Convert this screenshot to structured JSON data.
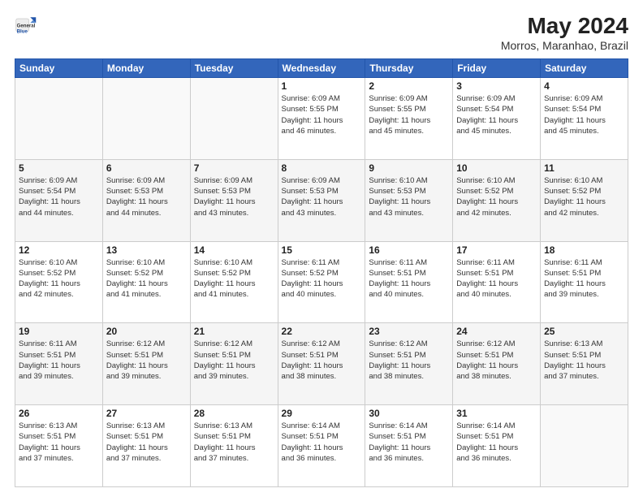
{
  "header": {
    "logo_general": "General",
    "logo_blue": "Blue",
    "title": "May 2024",
    "location": "Morros, Maranhao, Brazil"
  },
  "days_of_week": [
    "Sunday",
    "Monday",
    "Tuesday",
    "Wednesday",
    "Thursday",
    "Friday",
    "Saturday"
  ],
  "weeks": [
    [
      {
        "num": "",
        "info": ""
      },
      {
        "num": "",
        "info": ""
      },
      {
        "num": "",
        "info": ""
      },
      {
        "num": "1",
        "info": "Sunrise: 6:09 AM\nSunset: 5:55 PM\nDaylight: 11 hours\nand 46 minutes."
      },
      {
        "num": "2",
        "info": "Sunrise: 6:09 AM\nSunset: 5:55 PM\nDaylight: 11 hours\nand 45 minutes."
      },
      {
        "num": "3",
        "info": "Sunrise: 6:09 AM\nSunset: 5:54 PM\nDaylight: 11 hours\nand 45 minutes."
      },
      {
        "num": "4",
        "info": "Sunrise: 6:09 AM\nSunset: 5:54 PM\nDaylight: 11 hours\nand 45 minutes."
      }
    ],
    [
      {
        "num": "5",
        "info": "Sunrise: 6:09 AM\nSunset: 5:54 PM\nDaylight: 11 hours\nand 44 minutes."
      },
      {
        "num": "6",
        "info": "Sunrise: 6:09 AM\nSunset: 5:53 PM\nDaylight: 11 hours\nand 44 minutes."
      },
      {
        "num": "7",
        "info": "Sunrise: 6:09 AM\nSunset: 5:53 PM\nDaylight: 11 hours\nand 43 minutes."
      },
      {
        "num": "8",
        "info": "Sunrise: 6:09 AM\nSunset: 5:53 PM\nDaylight: 11 hours\nand 43 minutes."
      },
      {
        "num": "9",
        "info": "Sunrise: 6:10 AM\nSunset: 5:53 PM\nDaylight: 11 hours\nand 43 minutes."
      },
      {
        "num": "10",
        "info": "Sunrise: 6:10 AM\nSunset: 5:52 PM\nDaylight: 11 hours\nand 42 minutes."
      },
      {
        "num": "11",
        "info": "Sunrise: 6:10 AM\nSunset: 5:52 PM\nDaylight: 11 hours\nand 42 minutes."
      }
    ],
    [
      {
        "num": "12",
        "info": "Sunrise: 6:10 AM\nSunset: 5:52 PM\nDaylight: 11 hours\nand 42 minutes."
      },
      {
        "num": "13",
        "info": "Sunrise: 6:10 AM\nSunset: 5:52 PM\nDaylight: 11 hours\nand 41 minutes."
      },
      {
        "num": "14",
        "info": "Sunrise: 6:10 AM\nSunset: 5:52 PM\nDaylight: 11 hours\nand 41 minutes."
      },
      {
        "num": "15",
        "info": "Sunrise: 6:11 AM\nSunset: 5:52 PM\nDaylight: 11 hours\nand 40 minutes."
      },
      {
        "num": "16",
        "info": "Sunrise: 6:11 AM\nSunset: 5:51 PM\nDaylight: 11 hours\nand 40 minutes."
      },
      {
        "num": "17",
        "info": "Sunrise: 6:11 AM\nSunset: 5:51 PM\nDaylight: 11 hours\nand 40 minutes."
      },
      {
        "num": "18",
        "info": "Sunrise: 6:11 AM\nSunset: 5:51 PM\nDaylight: 11 hours\nand 39 minutes."
      }
    ],
    [
      {
        "num": "19",
        "info": "Sunrise: 6:11 AM\nSunset: 5:51 PM\nDaylight: 11 hours\nand 39 minutes."
      },
      {
        "num": "20",
        "info": "Sunrise: 6:12 AM\nSunset: 5:51 PM\nDaylight: 11 hours\nand 39 minutes."
      },
      {
        "num": "21",
        "info": "Sunrise: 6:12 AM\nSunset: 5:51 PM\nDaylight: 11 hours\nand 39 minutes."
      },
      {
        "num": "22",
        "info": "Sunrise: 6:12 AM\nSunset: 5:51 PM\nDaylight: 11 hours\nand 38 minutes."
      },
      {
        "num": "23",
        "info": "Sunrise: 6:12 AM\nSunset: 5:51 PM\nDaylight: 11 hours\nand 38 minutes."
      },
      {
        "num": "24",
        "info": "Sunrise: 6:12 AM\nSunset: 5:51 PM\nDaylight: 11 hours\nand 38 minutes."
      },
      {
        "num": "25",
        "info": "Sunrise: 6:13 AM\nSunset: 5:51 PM\nDaylight: 11 hours\nand 37 minutes."
      }
    ],
    [
      {
        "num": "26",
        "info": "Sunrise: 6:13 AM\nSunset: 5:51 PM\nDaylight: 11 hours\nand 37 minutes."
      },
      {
        "num": "27",
        "info": "Sunrise: 6:13 AM\nSunset: 5:51 PM\nDaylight: 11 hours\nand 37 minutes."
      },
      {
        "num": "28",
        "info": "Sunrise: 6:13 AM\nSunset: 5:51 PM\nDaylight: 11 hours\nand 37 minutes."
      },
      {
        "num": "29",
        "info": "Sunrise: 6:14 AM\nSunset: 5:51 PM\nDaylight: 11 hours\nand 36 minutes."
      },
      {
        "num": "30",
        "info": "Sunrise: 6:14 AM\nSunset: 5:51 PM\nDaylight: 11 hours\nand 36 minutes."
      },
      {
        "num": "31",
        "info": "Sunrise: 6:14 AM\nSunset: 5:51 PM\nDaylight: 11 hours\nand 36 minutes."
      },
      {
        "num": "",
        "info": ""
      }
    ]
  ]
}
